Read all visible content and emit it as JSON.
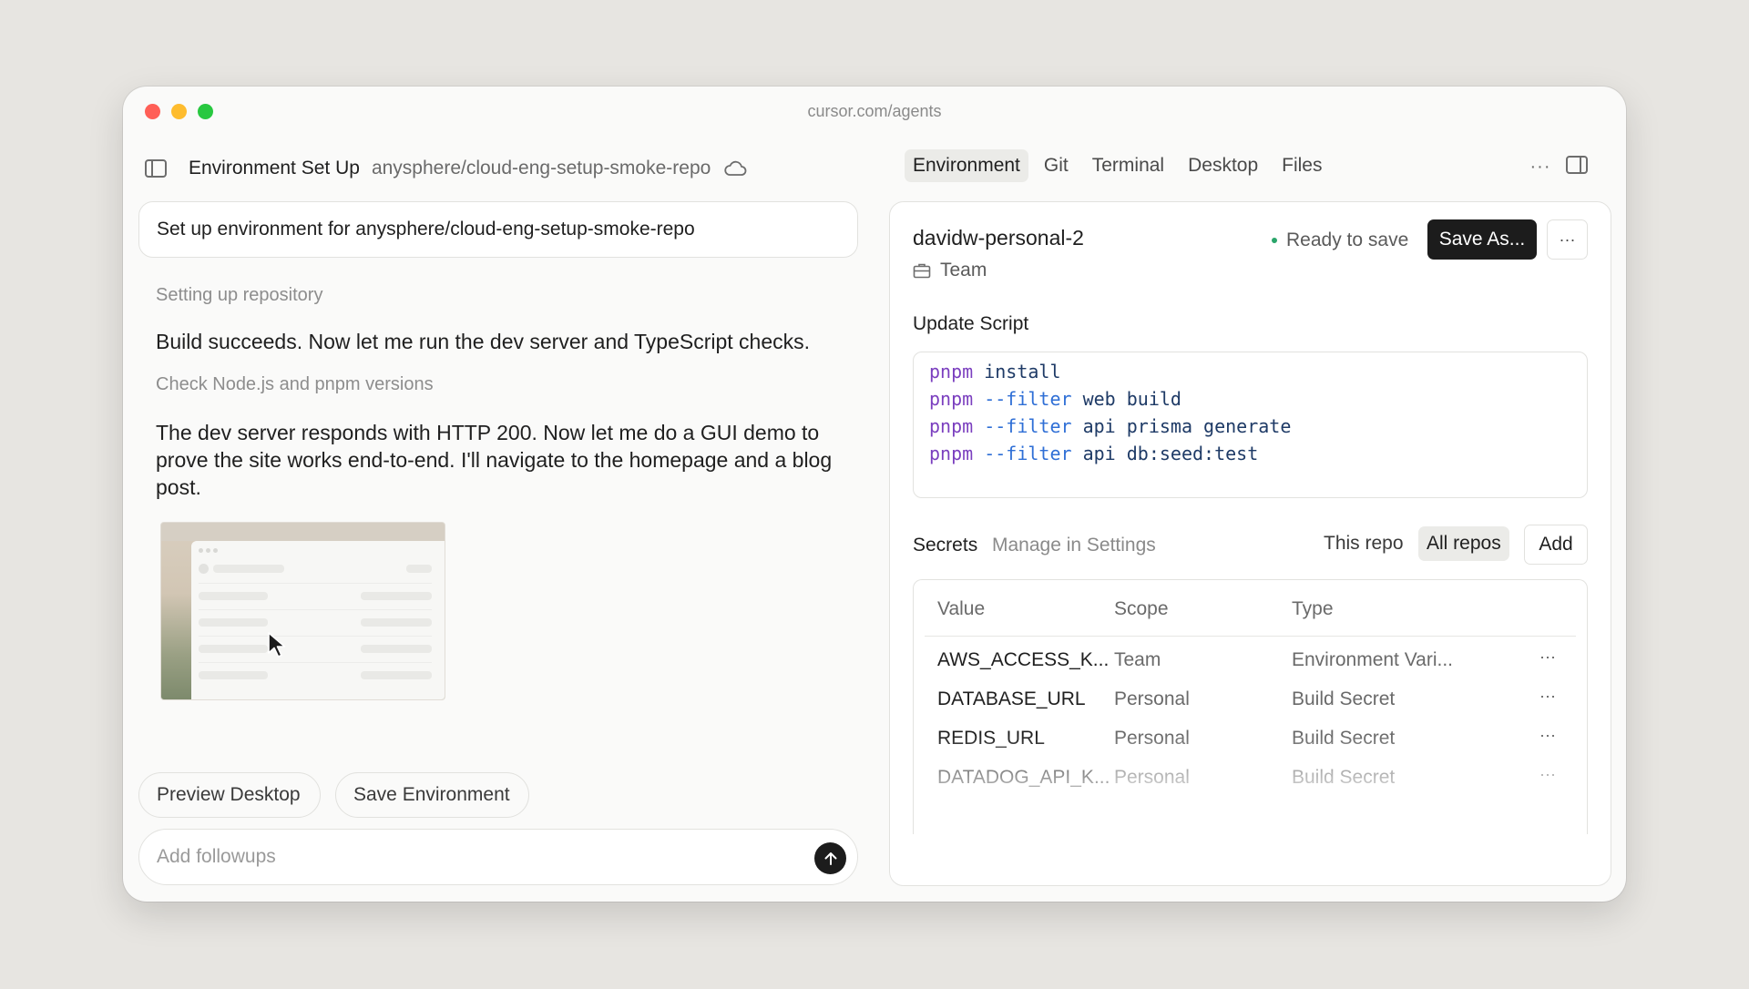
{
  "window": {
    "url": "cursor.com/agents"
  },
  "header": {
    "title": "Environment Set Up",
    "repo": "anysphere/cloud-eng-setup-smoke-repo"
  },
  "tabs": [
    {
      "label": "Environment",
      "active": true
    },
    {
      "label": "Git",
      "active": false
    },
    {
      "label": "Terminal",
      "active": false
    },
    {
      "label": "Desktop",
      "active": false
    },
    {
      "label": "Files",
      "active": false
    }
  ],
  "chat": {
    "prompt": "Set up environment for anysphere/cloud-eng-setup-smoke-repo",
    "steps": [
      {
        "status": "Setting up repository",
        "message": "Build succeeds. Now let me run the dev server and TypeScript checks."
      },
      {
        "status": "Check Node.js and pnpm versions",
        "message": "The dev server responds with HTTP 200. Now let me do a GUI demo to prove the site works end-to-end. I'll navigate to the homepage and a blog post."
      }
    ],
    "actions": {
      "preview": "Preview Desktop",
      "save": "Save Environment"
    },
    "followup_placeholder": "Add followups",
    "followup_value": ""
  },
  "environment": {
    "name": "davidw-personal-2",
    "owner": "Team",
    "status": "Ready to save",
    "status_color": "#2aa56a",
    "save_as_label": "Save As...",
    "more_label": "···",
    "update_script_label": "Update Script",
    "script": [
      {
        "cmd": "pnpm",
        "flag": "",
        "args": "install"
      },
      {
        "cmd": "pnpm",
        "flag": "--filter",
        "args": "web build"
      },
      {
        "cmd": "pnpm",
        "flag": "--filter",
        "args": "api prisma generate"
      },
      {
        "cmd": "pnpm",
        "flag": "--filter",
        "args": "api db:seed:test"
      }
    ]
  },
  "secrets": {
    "label": "Secrets",
    "manage_link": "Manage in Settings",
    "scope_this": "This repo",
    "scope_all": "All repos",
    "add_label": "Add",
    "columns": [
      "Value",
      "Scope",
      "Type"
    ],
    "rows": [
      {
        "value": "AWS_ACCESS_K...",
        "scope": "Team",
        "type": "Environment Vari..."
      },
      {
        "value": "DATABASE_URL",
        "scope": "Personal",
        "type": "Build Secret"
      },
      {
        "value": "REDIS_URL",
        "scope": "Personal",
        "type": "Build Secret"
      },
      {
        "value": "DATADOG_API_K...",
        "scope": "Personal",
        "type": "Build Secret"
      }
    ]
  },
  "colors": {
    "accent_dark": "#1c1c1c",
    "traffic_red": "#ff5f57",
    "traffic_yellow": "#febc2e",
    "traffic_green": "#28c840"
  },
  "icons": [
    "sidebar-toggle-icon",
    "cloud-icon",
    "more-horizontal-icon",
    "panel-right-icon",
    "briefcase-icon",
    "arrow-up-icon",
    "cursor-pointer-icon"
  ]
}
